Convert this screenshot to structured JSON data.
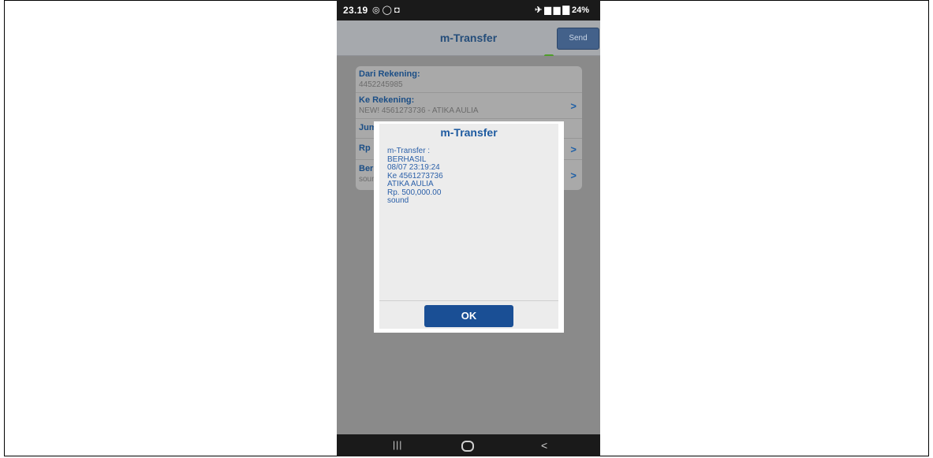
{
  "status": {
    "time": "23.19",
    "left_icons": "◎ ◯ ◘",
    "right_icons": "✈ ▆ ▆ ▇",
    "battery": "24%"
  },
  "appbar": {
    "title": "m-Transfer",
    "send_label": "Send",
    "status_color": "#4f9e2a"
  },
  "form": {
    "rows": [
      {
        "label": "Dari Rekening:",
        "value": "4452245985",
        "chevron": ""
      },
      {
        "label": "Ke Rekening:",
        "value": "NEW! 4561273736 - ATIKA AULIA",
        "chevron": ">"
      },
      {
        "label": "Jumlah:",
        "value": "",
        "chevron": ""
      },
      {
        "label": "Rp",
        "value": "",
        "chevron": ">"
      },
      {
        "label": "Berita:",
        "value": "sound",
        "chevron": ">"
      }
    ]
  },
  "dialog": {
    "title": "m-Transfer",
    "lines": [
      "m-Transfer :",
      "BERHASIL",
      "08/07 23:19:24",
      "Ke 4561273736",
      "ATIKA AULIA",
      "Rp. 500,000.00",
      "sound"
    ],
    "ok_label": "OK"
  },
  "navbar": {
    "recents_icon": "|||",
    "back_icon": "<"
  }
}
